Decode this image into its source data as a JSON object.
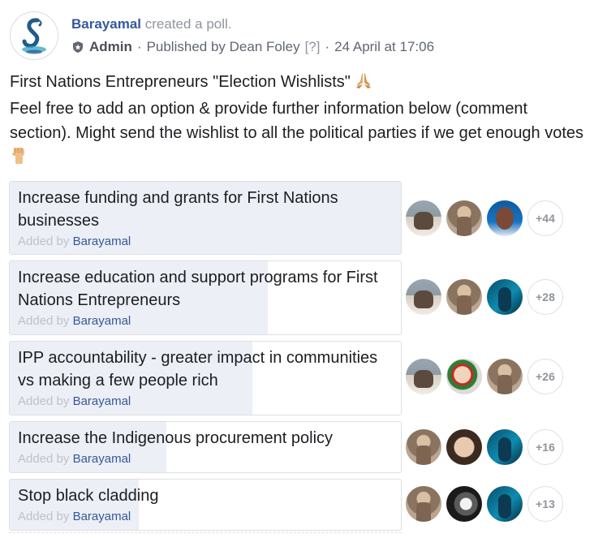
{
  "post": {
    "page_name": "Barayamal",
    "action": "created a poll.",
    "role": "Admin",
    "published_by": "Published by Dean Foley",
    "help_mark": "[?]",
    "date": "24 April at 17:06",
    "title_line": "First Nations Entrepreneurs \"Election Wishlists\"",
    "body_line": "Feel free to add an option & provide further information below (comment section). Might send the wishlist to all the political parties if we get enough votes",
    "colors": {
      "link": "#365899",
      "muted": "#90949c",
      "fill": "#eceff5",
      "border": "#dddfe2"
    }
  },
  "poll": {
    "options": [
      {
        "label": "Increase funding and grants for First Nations businesses",
        "added_prefix": "Added by",
        "added_by": "Barayamal",
        "more": "+44",
        "fill_fraction": 1.0,
        "avatars": [
          "a",
          "b",
          "c"
        ]
      },
      {
        "label": "Increase education and support programs for First Nations Entrepreneurs",
        "added_prefix": "Added by",
        "added_by": "Barayamal",
        "more": "+28",
        "fill_fraction": 0.66,
        "avatars": [
          "a",
          "b",
          "d"
        ]
      },
      {
        "label": "IPP accountability - greater impact in communities vs making a few people rich",
        "added_prefix": "Added by",
        "added_by": "Barayamal",
        "more": "+26",
        "fill_fraction": 0.62,
        "avatars": [
          "a",
          "e",
          "b"
        ]
      },
      {
        "label": "Increase the Indigenous procurement policy",
        "added_prefix": "Added by",
        "added_by": "Barayamal",
        "more": "+16",
        "fill_fraction": 0.4,
        "avatars": [
          "b",
          "f",
          "d"
        ]
      },
      {
        "label": "Stop black cladding",
        "added_prefix": "Added by",
        "added_by": "Barayamal",
        "more": "+13",
        "fill_fraction": 0.33,
        "avatars": [
          "b",
          "g",
          "d"
        ]
      }
    ]
  }
}
